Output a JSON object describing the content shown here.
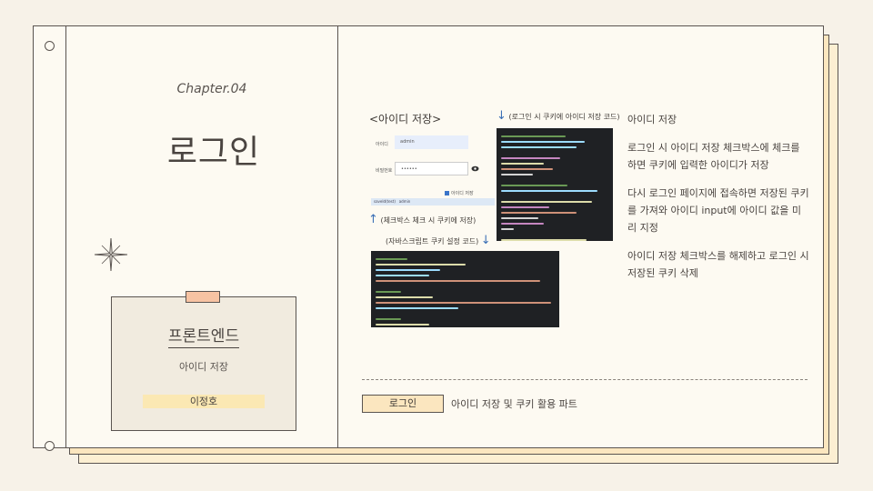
{
  "left_page": {
    "chapter": "Chapter.04",
    "title": "로그인",
    "card": {
      "title": "프론트엔드",
      "subtitle": "아이디 저장",
      "author": "이정호"
    }
  },
  "right_page": {
    "section_heading": "<아이디 저장>",
    "form": {
      "id_label": "아이디",
      "id_value": "admin",
      "pw_label": "비밀번호",
      "pw_value": "••••••",
      "remember_label": "아이디 저장",
      "cookie_name": "saveId(test)",
      "cookie_value": "admin"
    },
    "captions": {
      "cookie_code": "(로그인 시 쿠키에 아이디 저장 코드)",
      "checkbox_save": "(체크박스 체크 시 쿠키에 저장)",
      "js_code": "(자바스크립트 쿠키 설정 코드)"
    },
    "bullets": [
      "아이디 저장",
      "로그인 시 아이디 저장 체크박스에 체크를 하면 쿠키에 입력한 아이디가 저장",
      "다시 로그인 페이지에 접속하면 저장된 쿠키를 가져와 아이디 input에 아이디 값을 미리 지정",
      "아이디 저장 체크박스를 해제하고 로그인 시 저장된 쿠키 삭제"
    ],
    "footer": {
      "tag": "로그인",
      "description": "아이디 저장 및 쿠키 활용 파트"
    }
  },
  "colors": {
    "background": "#f7f2e8",
    "page": "#fdfaf2",
    "stack_page": "#fbe6bf",
    "card": "#f1ebdf",
    "tape": "#f7c3a3",
    "author_highlight": "#fbe8b3",
    "accent_arrow": "#3a6fb5",
    "code_bg": "#1f2124"
  }
}
